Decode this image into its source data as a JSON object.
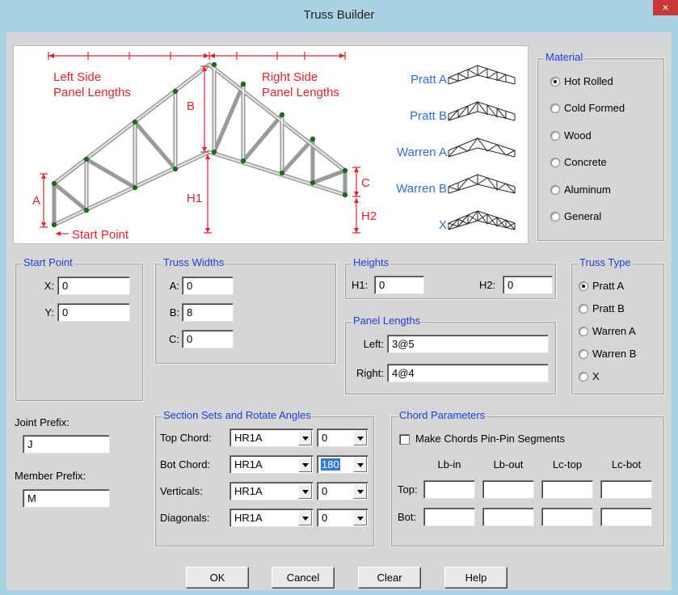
{
  "window": {
    "title": "Truss Builder",
    "close_glyph": "×"
  },
  "diagram": {
    "labels": {
      "left_side": "Left Side",
      "left_panel": "Panel Lengths",
      "right_side": "Right Side",
      "right_panel": "Panel Lengths",
      "a": "A",
      "b": "B",
      "c": "C",
      "h1": "H1",
      "h2": "H2",
      "start_point": "Start Point"
    },
    "type_labels": [
      "Pratt A",
      "Pratt B",
      "Warren A",
      "Warren B",
      "X"
    ],
    "colors": {
      "dimension": "#e8202a",
      "link": "#2f6de0",
      "member": "#8a8a8a",
      "joint": "#1e6b1e"
    }
  },
  "material": {
    "title": "Material",
    "options": [
      "Hot Rolled",
      "Cold Formed",
      "Wood",
      "Concrete",
      "Aluminum",
      "General"
    ],
    "selected": "Hot Rolled"
  },
  "start_point": {
    "title": "Start Point",
    "x_label": "X:",
    "x_value": "0",
    "y_label": "Y:",
    "y_value": "0"
  },
  "truss_widths": {
    "title": "Truss Widths",
    "a_label": "A:",
    "a_value": "0",
    "b_label": "B:",
    "b_value": "8",
    "c_label": "C:",
    "c_value": "0"
  },
  "heights": {
    "title": "Heights",
    "h1_label": "H1:",
    "h1_value": "0",
    "h2_label": "H2:",
    "h2_value": "0"
  },
  "panel_lengths": {
    "title": "Panel Lengths",
    "left_label": "Left:",
    "left_value": "3@5",
    "right_label": "Right:",
    "right_value": "4@4"
  },
  "truss_type": {
    "title": "Truss Type",
    "options": [
      "Pratt A",
      "Pratt B",
      "Warren A",
      "Warren B",
      "X"
    ],
    "selected": "Pratt A"
  },
  "prefixes": {
    "joint_label": "Joint Prefix:",
    "joint_value": "J",
    "member_label": "Member Prefix:",
    "member_value": "M"
  },
  "section_sets": {
    "title": "Section Sets and Rotate Angles",
    "rows": [
      {
        "label": "Top Chord:",
        "section": "HR1A",
        "angle": "0"
      },
      {
        "label": "Bot Chord:",
        "section": "HR1A",
        "angle": "180"
      },
      {
        "label": "Verticals:",
        "section": "HR1A",
        "angle": "0"
      },
      {
        "label": "Diagonals:",
        "section": "HR1A",
        "angle": "0"
      }
    ]
  },
  "chord_params": {
    "title": "Chord Parameters",
    "pin_label": "Make Chords Pin-Pin Segments",
    "pin_checked": false,
    "columns": [
      "Lb-in",
      "Lb-out",
      "Lc-top",
      "Lc-bot"
    ],
    "row_labels": [
      "Top:",
      "Bot:"
    ]
  },
  "buttons": {
    "ok": "OK",
    "cancel": "Cancel",
    "clear": "Clear",
    "help": "Help"
  }
}
